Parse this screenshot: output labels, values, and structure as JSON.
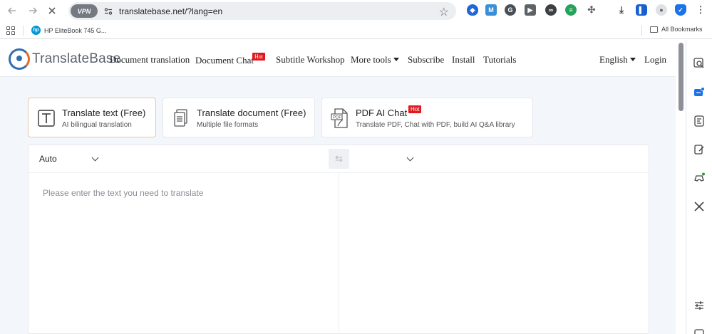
{
  "browser": {
    "vpn_label": "VPN",
    "url": "translatebase.net/?lang=en",
    "bookmark_item": "HP EliteBook 745 G...",
    "all_bookmarks": "All Bookmarks"
  },
  "header": {
    "logo_text": "TranslateBase",
    "nav": {
      "document_translation": "Document translation",
      "document_chat": "Document Chat",
      "hot": "Hot",
      "subtitle_workshop": "Subtitle Workshop",
      "more_tools": "More tools",
      "subscribe": "Subscribe",
      "install": "Install",
      "tutorials": "Tutorials",
      "language": "English",
      "login": "Login"
    }
  },
  "modes": [
    {
      "title": "Translate text (Free)",
      "subtitle": "AI bilingual translation",
      "icon": "text-t-icon",
      "active": true
    },
    {
      "title": "Translate document (Free)",
      "subtitle": "Multiple file formats",
      "icon": "document-icon",
      "active": false
    },
    {
      "title": "PDF AI Chat",
      "badge": "Hot",
      "subtitle": "Translate PDF, Chat with PDF, build AI Q&A library",
      "icon": "pdf-icon",
      "active": false
    }
  ],
  "translator": {
    "source_language": "Auto",
    "target_language": "",
    "source_placeholder": "Please enter the text you need to translate"
  },
  "colors": {
    "accent_blue": "#2f6db5",
    "accent_orange": "#e4682c",
    "hot_red": "#e1191e",
    "page_bg": "#f3f6fb"
  }
}
